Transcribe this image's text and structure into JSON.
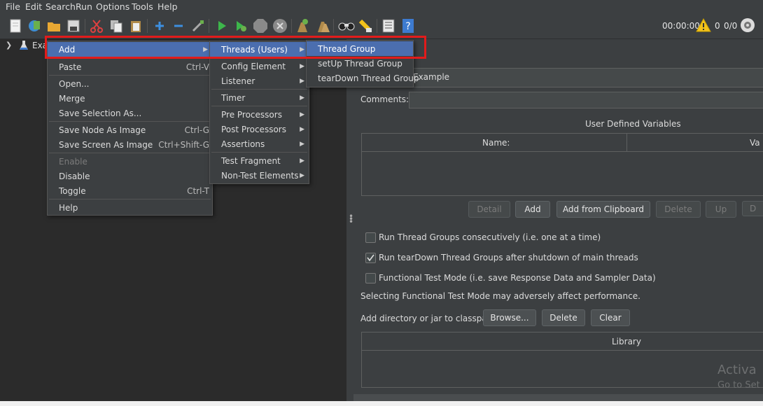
{
  "menubar": {
    "items": [
      {
        "label": "File"
      },
      {
        "label": "Edit"
      },
      {
        "label": "Search"
      },
      {
        "label": "Run"
      },
      {
        "label": "Options"
      },
      {
        "label": "Tools"
      },
      {
        "label": "Help"
      }
    ]
  },
  "toolbar": {
    "timer": "00:00:00",
    "warnings": "0",
    "threads": "0/0"
  },
  "tree": {
    "root_label": "Exa"
  },
  "context_menu": {
    "items": [
      {
        "label": "Add",
        "shortcut": "",
        "submenu": true
      },
      {
        "label": "Paste",
        "shortcut": "Ctrl-V"
      },
      {
        "label": "Open..."
      },
      {
        "label": "Merge"
      },
      {
        "label": "Save Selection As..."
      },
      {
        "label": "Save Node As Image",
        "shortcut": "Ctrl-G"
      },
      {
        "label": "Save Screen As Image",
        "shortcut": "Ctrl+Shift-G"
      },
      {
        "label": "Enable",
        "disabled": true
      },
      {
        "label": "Disable"
      },
      {
        "label": "Toggle",
        "shortcut": "Ctrl-T"
      },
      {
        "label": "Help"
      }
    ]
  },
  "add_submenu": {
    "items": [
      {
        "label": "Threads (Users)"
      },
      {
        "label": "Config Element"
      },
      {
        "label": "Listener"
      },
      {
        "label": "Timer"
      },
      {
        "label": "Pre Processors"
      },
      {
        "label": "Post Processors"
      },
      {
        "label": "Assertions"
      },
      {
        "label": "Test Fragment"
      },
      {
        "label": "Non-Test Elements"
      }
    ]
  },
  "threads_submenu": {
    "items": [
      {
        "label": "Thread Group"
      },
      {
        "label": "setUp Thread Group"
      },
      {
        "label": "tearDown Thread Group"
      }
    ]
  },
  "test_plan": {
    "name_value": "Example",
    "comments_label": "Comments:",
    "udv_title": "User Defined Variables",
    "col_name": "Name:",
    "col_value": "Va",
    "buttons": {
      "detail": "Detail",
      "add": "Add",
      "add_clipboard": "Add from Clipboard",
      "delete": "Delete",
      "up": "Up",
      "down": "D"
    },
    "opt_consecutive": "Run Thread Groups consecutively (i.e. one at a time)",
    "opt_teardown": "Run tearDown Thread Groups after shutdown of main threads",
    "opt_functional": "Functional Test Mode (i.e. save Response Data and Sampler Data)",
    "functional_note": "Selecting Functional Test Mode may adversely affect performance.",
    "classpath_label": "Add directory or jar to classpath",
    "browse": "Browse...",
    "cp_delete": "Delete",
    "cp_clear": "Clear",
    "library_header": "Library"
  },
  "watermark": {
    "line1": "Activa",
    "line2": "Go to Set"
  },
  "colors": {
    "background": "#3c3f41",
    "selection": "#4b6eaf",
    "highlight_box": "#e21b1b"
  }
}
